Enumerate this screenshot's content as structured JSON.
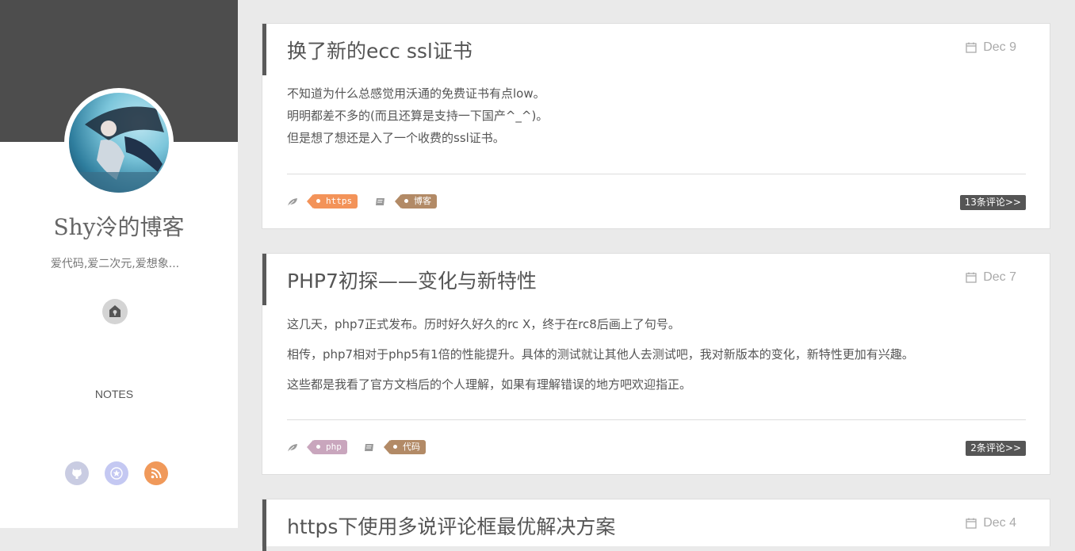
{
  "sidebar": {
    "blog_title": "Shy泠的博客",
    "subtitle": "爱代码,爱二次元,爱想象...",
    "notes_label": "NOTES",
    "social": [
      {
        "icon": "github-icon",
        "color": "#c9cce2"
      },
      {
        "icon": "star-icon",
        "color": "#c4c8f2"
      },
      {
        "icon": "rss-icon",
        "color": "#f0995a"
      }
    ]
  },
  "posts": [
    {
      "title": "换了新的ecc ssl证书",
      "date": "Dec 9",
      "body": [
        "不知道为什么总感觉用沃通的免费证书有点low。",
        "明明都差不多的(而且还算是支持一下国产^_^)。",
        "但是想了想还是入了一个收费的ssl证书。"
      ],
      "tag": "https",
      "category": "博客",
      "comments": "13条评论>>"
    },
    {
      "title": "PHP7初探——变化与新特性",
      "date": "Dec 7",
      "body": [
        "这几天，php7正式发布。历时好久好久的rc X，终于在rc8后画上了句号。",
        "相传，php7相对于php5有1倍的性能提升。具体的测试就让其他人去测试吧，我对新版本的变化，新特性更加有兴趣。",
        "这些都是我看了官方文档后的个人理解，如果有理解错误的地方吧欢迎指正。"
      ],
      "tag": "php",
      "category": "代码",
      "comments": "2条评论>>"
    },
    {
      "title": "https下使用多说评论框最优解决方案",
      "date": "Dec 4"
    }
  ],
  "colors": {
    "sidebar_header": "#4d4d4d",
    "tag_https": "#f39359",
    "tag_category": "#b28a66",
    "tag_php": "#c9a6bd",
    "comment_badge": "#555555"
  }
}
